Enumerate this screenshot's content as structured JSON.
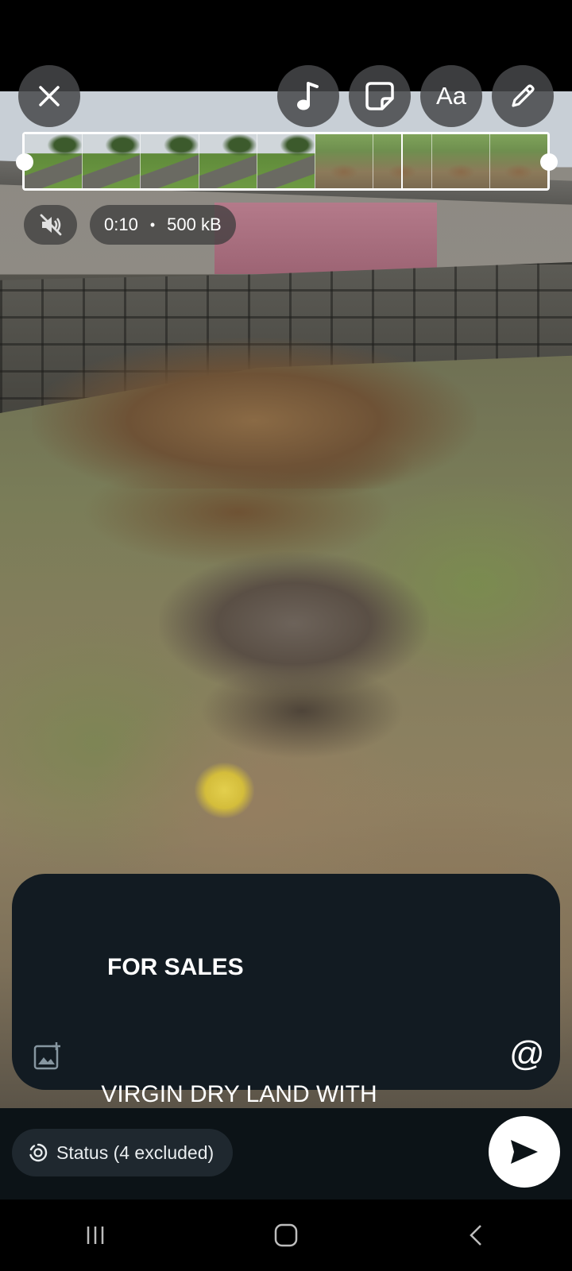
{
  "editor": {
    "top_actions": [
      {
        "name": "close",
        "icon": "close-icon"
      },
      {
        "name": "music",
        "icon": "music-note-icon"
      },
      {
        "name": "sticker",
        "icon": "sticker-icon"
      },
      {
        "name": "text",
        "icon": "text-icon",
        "label": "Aa"
      },
      {
        "name": "draw",
        "icon": "pencil-icon"
      }
    ],
    "video_info": {
      "duration": "0:10",
      "separator": "•",
      "size": "500 kB",
      "muted": true
    },
    "timeline_frames": [
      "tree",
      "tree",
      "tree",
      "tree",
      "tree",
      "ground",
      "ground-split",
      "ground",
      "ground"
    ]
  },
  "caption": {
    "heading": "FOR SALES",
    "body": " VIRGIN DRY LAND WITH\nFENCE NOT GATED AND IT'S\nHAS SURVEY, DEED OF\nASSIGNMENT AND OMO ONILE"
  },
  "footer": {
    "status_label": "Status (4 excluded)",
    "send_icon": "send-icon"
  },
  "colors": {
    "caption_bg": "#121b22",
    "bottom_bar_bg": "#0c1317",
    "pill_bg": "#1f282f",
    "send_bg": "#ffffff"
  }
}
